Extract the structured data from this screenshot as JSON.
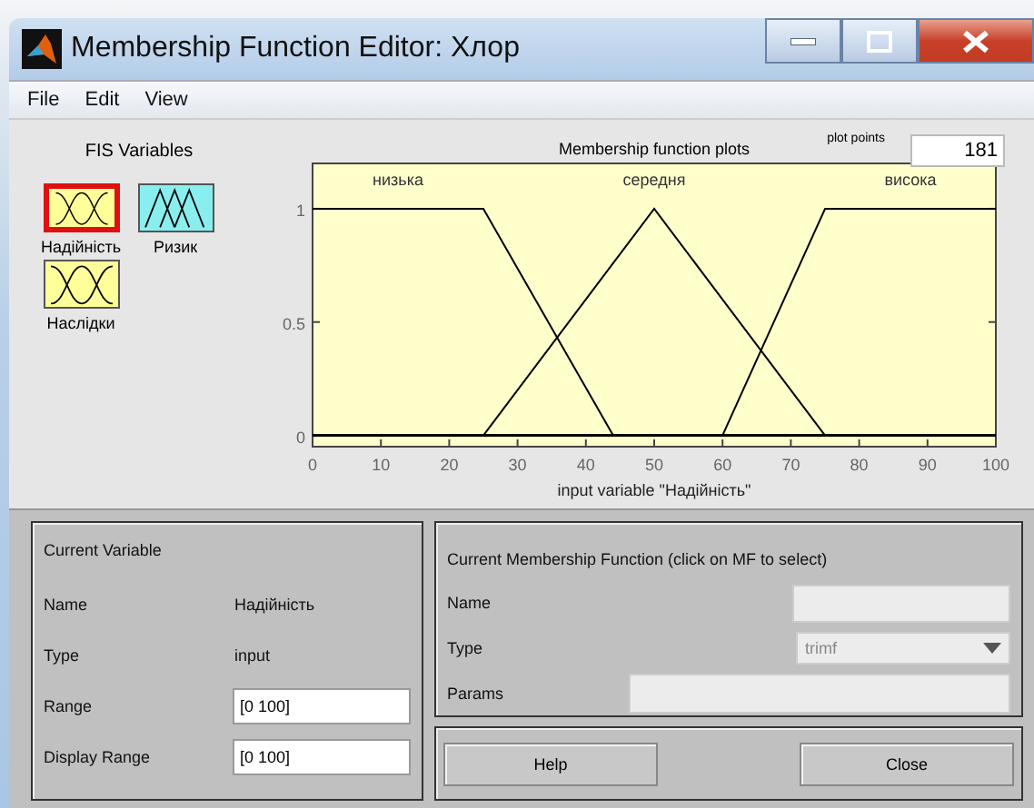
{
  "window": {
    "title": "Membership Function Editor: Хлор"
  },
  "menu": [
    "File",
    "Edit",
    "View"
  ],
  "fis_variables": {
    "title": "FIS Variables",
    "items": [
      {
        "label": "Надійність",
        "kind": "input",
        "selected": true
      },
      {
        "label": "Ризик",
        "kind": "output",
        "selected": false
      },
      {
        "label": "Наслідки",
        "kind": "input",
        "selected": false
      }
    ]
  },
  "plot": {
    "plot_points_label": "plot points",
    "plot_points": "181",
    "chart_data": {
      "type": "line",
      "title": "Membership function plots",
      "xlabel": "input variable \"Надійність\"",
      "x": [
        0,
        25,
        44,
        50,
        60,
        75,
        100
      ],
      "series": [
        {
          "name": "низька",
          "color": "#000000",
          "values": [
            1,
            1,
            0,
            null,
            null,
            null,
            null
          ]
        },
        {
          "name": "середня",
          "color": "#000000",
          "values": [
            null,
            0,
            0.76,
            1,
            0.6,
            0,
            null
          ]
        },
        {
          "name": "висока",
          "color": "#000000",
          "values": [
            null,
            null,
            null,
            null,
            0,
            1,
            1
          ]
        }
      ],
      "xlim": [
        0,
        100
      ],
      "ylim": [
        -0.05,
        1.2
      ],
      "xticks": [
        0,
        10,
        20,
        30,
        40,
        50,
        60,
        70,
        80,
        90,
        100
      ],
      "yticks": [
        0,
        {
          "value": 0.5,
          "label": "0.5"
        },
        1
      ]
    }
  },
  "current_variable": {
    "title": "Current Variable",
    "rows": [
      {
        "label": "Name",
        "kind": "text",
        "value": "Надійність"
      },
      {
        "label": "Type",
        "kind": "text",
        "value": "input"
      },
      {
        "label": "Range",
        "kind": "field",
        "value": "[0 100]"
      },
      {
        "label": "Display Range",
        "kind": "field",
        "value": "[0 100]"
      }
    ]
  },
  "current_mf": {
    "title": "Current Membership Function (click on MF to select)",
    "rows": [
      {
        "label": "Name",
        "kind": "field",
        "disabled": true
      },
      {
        "label": "Type",
        "kind": "dropdown",
        "value": "trimf",
        "disabled": true
      },
      {
        "label": "Params",
        "kind": "wide_field",
        "disabled": true
      }
    ]
  },
  "buttons": [
    "Help",
    "Close"
  ]
}
